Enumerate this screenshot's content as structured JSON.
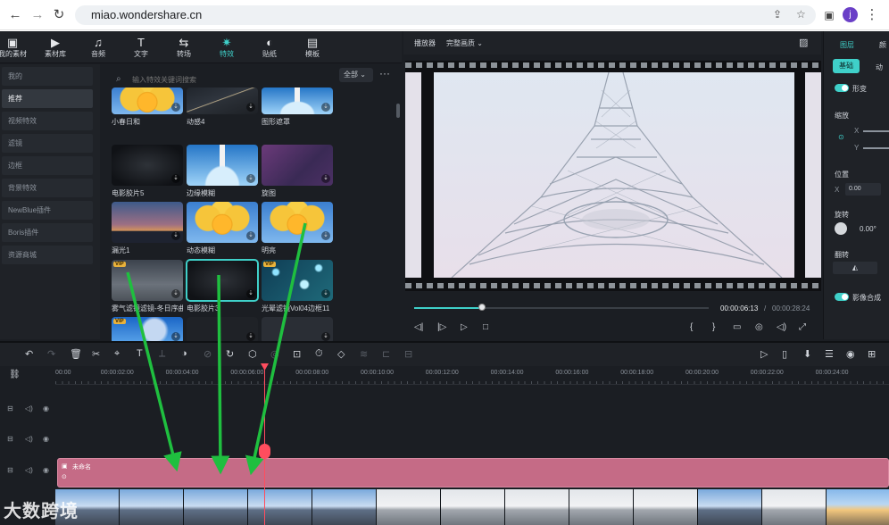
{
  "browser": {
    "url": "miao.wondershare.cn",
    "profile_initial": "j"
  },
  "media_tabs": [
    {
      "label": "我的素材",
      "icon": "folder-icon",
      "glyph": "▣"
    },
    {
      "label": "素材库",
      "icon": "media-library-icon",
      "glyph": "▶"
    },
    {
      "label": "音频",
      "icon": "music-icon",
      "glyph": "♫"
    },
    {
      "label": "文字",
      "icon": "text-icon",
      "glyph": "T"
    },
    {
      "label": "转场",
      "icon": "transition-icon",
      "glyph": "⇆"
    },
    {
      "label": "特效",
      "icon": "effects-icon",
      "glyph": "✷",
      "active": true
    },
    {
      "label": "贴纸",
      "icon": "sticker-icon",
      "glyph": "◐"
    },
    {
      "label": "模板",
      "icon": "template-icon",
      "glyph": "▤"
    }
  ],
  "sidebar": {
    "items": [
      {
        "label": "我的"
      },
      {
        "label": "推荐",
        "active": true
      },
      {
        "label": "视频特效"
      },
      {
        "label": "滤镜"
      },
      {
        "label": "边框"
      },
      {
        "label": "背景特效"
      },
      {
        "label": "NewBlue插件"
      },
      {
        "label": "Boris插件"
      },
      {
        "label": "资源商城"
      }
    ],
    "collapse_glyph": "‹"
  },
  "effects": {
    "search_placeholder": "输入特效关键词搜索",
    "filter_label": "全部 ⌄",
    "more_glyph": "···",
    "cards": [
      {
        "label": "小春日和",
        "art": "t-flower"
      },
      {
        "label": "动感4",
        "art": "t-road"
      },
      {
        "label": "图形遮罩",
        "art": "t-lighthouse"
      },
      {
        "label": "电影胶片5",
        "art": "t-dark"
      },
      {
        "label": "边缘模糊",
        "art": "t-lighthouse"
      },
      {
        "label": "旋图",
        "art": "t-purple"
      },
      {
        "label": "漏光1",
        "art": "t-sunset"
      },
      {
        "label": "动态模糊",
        "art": "t-flower"
      },
      {
        "label": "明亮",
        "art": "t-flower"
      },
      {
        "label": "雾气滤镜滤镜-冬日序曲",
        "art": "t-fog",
        "vip": true
      },
      {
        "label": "电影胶片3",
        "art": "t-dark",
        "selected": true
      },
      {
        "label": "光晕滤镜Vol04边框11",
        "art": "t-bokeh",
        "vip": true
      },
      {
        "label": "",
        "art": "t-blue",
        "vip": true
      },
      {
        "label": "",
        "art": "t-robot"
      },
      {
        "label": "",
        "art": "t-gray"
      }
    ],
    "vip_label": "VIP"
  },
  "player": {
    "title": "播放器",
    "quality": "完整画质 ⌄",
    "current_time": "00:00:06:13",
    "separator": "/",
    "total_time": "00:00:28:24",
    "progress": 0.23,
    "controls": [
      "◁|",
      "|▷",
      "▷",
      "□",
      "{",
      "}",
      "▭",
      "◎",
      "◁)",
      "⤢"
    ]
  },
  "inspector": {
    "tab_image": "图层",
    "tab_other": "颜",
    "basic": "基础",
    "anim": "动",
    "transform": "形变",
    "scale": "缩放",
    "axis_x": "X",
    "axis_y": "Y",
    "position": "位置",
    "pos_x_label": "X",
    "pos_x": "0.00",
    "rotate": "旋转",
    "rotate_value": "0.00°",
    "flip": "翻转",
    "composite": "影像合成"
  },
  "timeline": {
    "tools": [
      "↶",
      "↷",
      "🗑",
      "✂",
      "⌖",
      "T",
      "⟂",
      "◑",
      "⊘",
      "↻",
      "⬡",
      "◎",
      "⊡",
      "⏱",
      "◇",
      "≋",
      "⊏",
      "⊟"
    ],
    "right_tools": [
      "▷",
      "▯",
      "⬇",
      "☰",
      "◉",
      "⊞"
    ],
    "ruler": [
      "00:00",
      "00:00:02:00",
      "00:00:04:00",
      "00:00:06:00",
      "00:00:08:00",
      "00:00:10:00",
      "00:00:12:00",
      "00:00:14:00",
      "00:00:16:00",
      "00:00:18:00",
      "00:00:20:00",
      "00:00:22:00",
      "00:00:24:00"
    ],
    "clip_name": "未命名"
  },
  "watermark": "大数跨境"
}
